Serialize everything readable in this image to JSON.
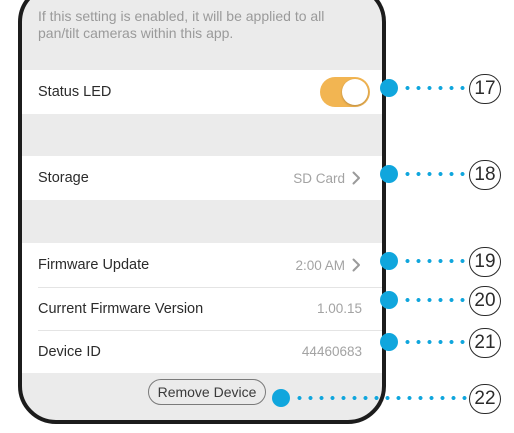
{
  "note": "If this setting is enabled, it will be applied to all pan/tilt cameras within this app.",
  "status_led": {
    "label": "Status LED",
    "enabled": true
  },
  "storage": {
    "label": "Storage",
    "value": "SD Card"
  },
  "firmware_update": {
    "label": "Firmware Update",
    "value": "2:00 AM"
  },
  "current_firmware": {
    "label": "Current Firmware Version",
    "value": "1.00.15"
  },
  "device_id": {
    "label": "Device ID",
    "value": "44460683"
  },
  "remove_device": {
    "label": "Remove Device"
  },
  "callouts": [
    "17",
    "18",
    "19",
    "20",
    "21",
    "22"
  ],
  "colors": {
    "toggle_on": "#f2b552",
    "callout": "#10a6dd"
  },
  "icons": {
    "chevron": "chevron-right-icon"
  }
}
